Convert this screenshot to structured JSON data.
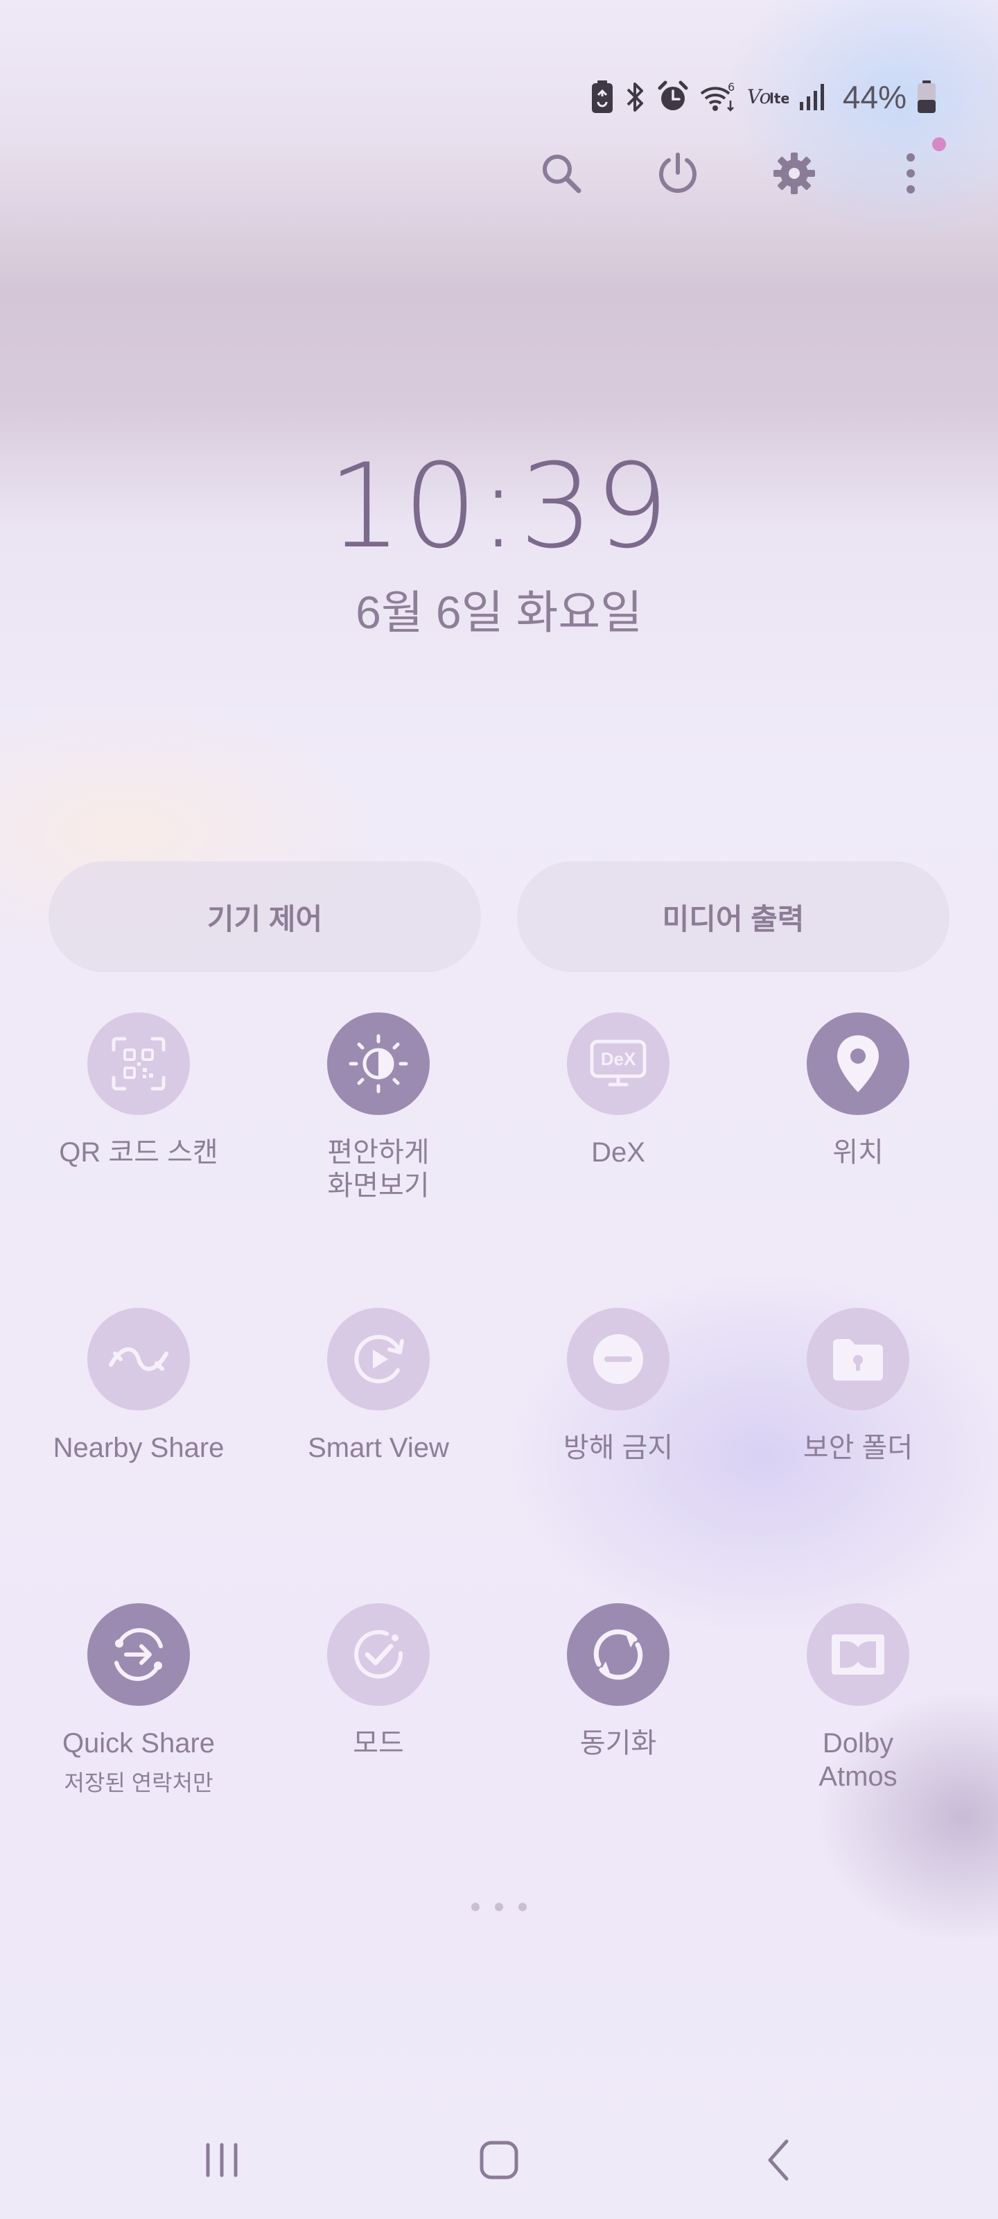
{
  "status_bar": {
    "icons": [
      "battery-saver-icon",
      "bluetooth-icon",
      "alarm-icon",
      "wifi-6-icon",
      "volte-icon",
      "signal-icon"
    ],
    "volte_label": "Vo",
    "volte_sub": "lte",
    "wifi_gen": "6",
    "battery_percent": "44%",
    "battery_level": 0.44
  },
  "top_actions": {
    "icons": [
      "search-icon",
      "power-icon",
      "gear-icon",
      "more-vertical-icon"
    ],
    "notification_dot_color": "#d789c6"
  },
  "clock": {
    "time": "10:39",
    "date": "6월 6일 화요일"
  },
  "pills": {
    "device_control": "기기 제어",
    "media_output": "미디어 출력"
  },
  "tiles": [
    {
      "label": "QR 코드 스캔",
      "icon": "qr-code-scan-icon",
      "active": false
    },
    {
      "label": "편안하게",
      "label2": "화면보기",
      "icon": "eye-comfort-icon",
      "active": true
    },
    {
      "label": "DeX",
      "icon": "dex-icon",
      "icon_text": "DeX",
      "active": false
    },
    {
      "label": "위치",
      "icon": "location-pin-icon",
      "active": true
    },
    {
      "label": "Nearby Share",
      "icon": "nearby-share-icon",
      "active": false
    },
    {
      "label": "Smart View",
      "icon": "smart-view-icon",
      "active": false
    },
    {
      "label": "방해 금지",
      "icon": "do-not-disturb-icon",
      "active": false
    },
    {
      "label": "보안 폴더",
      "icon": "secure-folder-icon",
      "active": false
    },
    {
      "label": "Quick Share",
      "sub": "저장된 연락처만",
      "icon": "quick-share-icon",
      "active": true
    },
    {
      "label": "모드",
      "icon": "modes-icon",
      "active": false
    },
    {
      "label": "동기화",
      "icon": "sync-icon",
      "active": true
    },
    {
      "label": "Dolby",
      "label2": "Atmos",
      "icon": "dolby-atmos-icon",
      "active": false
    }
  ],
  "colors": {
    "tile_on": "#9b8bb0",
    "tile_off": "#d8c9e4",
    "text": "#8d7f98",
    "clock": "#7b6a8c"
  },
  "nav_bar": {
    "icons": [
      "recent-apps-icon",
      "home-icon",
      "back-icon"
    ]
  }
}
